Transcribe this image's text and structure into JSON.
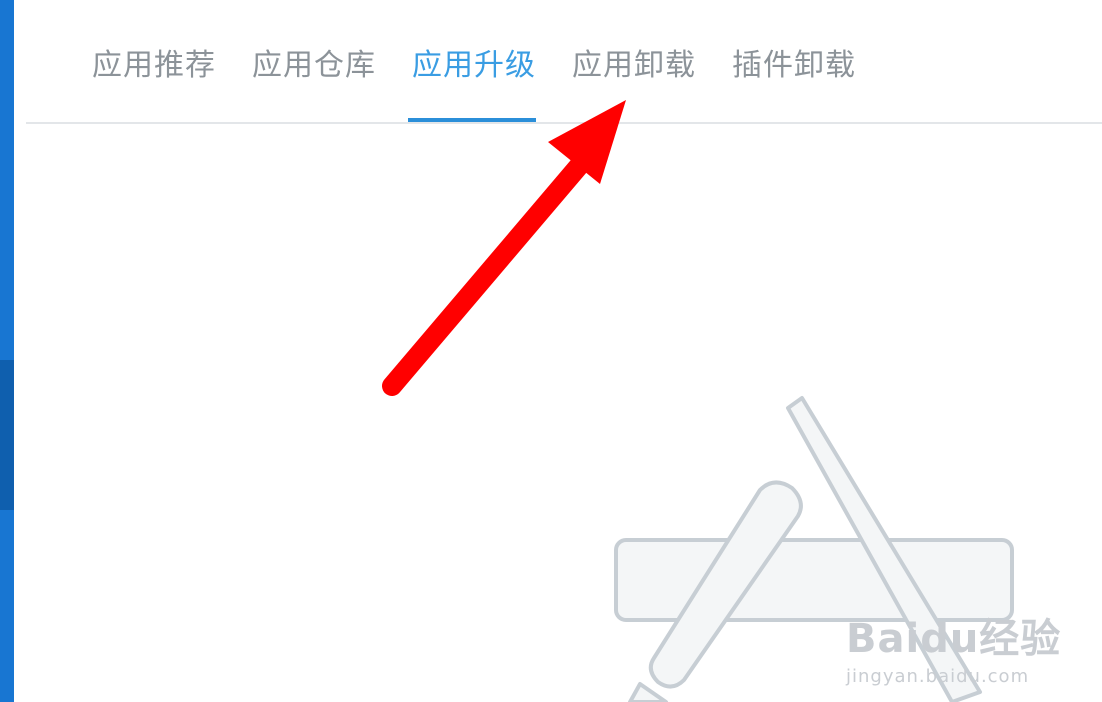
{
  "tabs": {
    "items": [
      {
        "label": "应用推荐"
      },
      {
        "label": "应用仓库"
      },
      {
        "label": "应用升级"
      },
      {
        "label": "应用卸载"
      },
      {
        "label": "插件卸载"
      }
    ],
    "active_index": 2
  },
  "colors": {
    "active_tab": "#3a9de3",
    "inactive_tab": "#8c9399",
    "accent_strip": "#1876d2",
    "annotation_arrow": "#ff0000"
  },
  "empty_state": {
    "icon": "app-store-icon"
  },
  "watermark": {
    "brand": "Baidu经验",
    "url": "jingyan.baidu.com"
  }
}
